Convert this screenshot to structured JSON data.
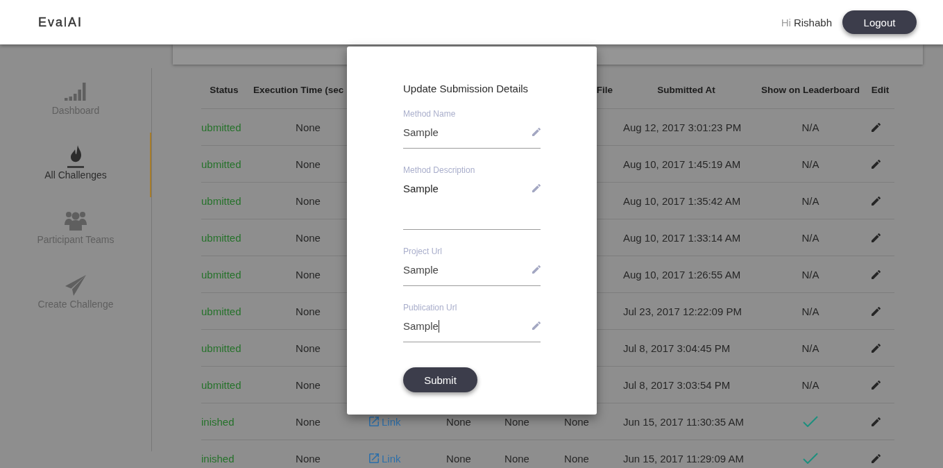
{
  "header": {
    "logo": "EvalAI",
    "greeting": "Hi",
    "user_name": "Rishabh",
    "logout_button": "Logout"
  },
  "sidebar": {
    "items": [
      {
        "label": "Dashboard",
        "selected": false
      },
      {
        "label": "All Challenges",
        "selected": true
      },
      {
        "label": "Participant Teams",
        "selected": false
      },
      {
        "label": "Create Challenge",
        "selected": false
      }
    ]
  },
  "table": {
    "columns": [
      "Status",
      "Execution Time (sec",
      "File",
      "Submitted At",
      "Show on Leaderboard",
      "Edit"
    ],
    "rows": [
      {
        "status": "ubmitted",
        "execution_time": "None",
        "submitted_at": "Aug 12, 2017 3:01:23 PM",
        "leaderboard": "N/A"
      },
      {
        "status": "ubmitted",
        "execution_time": "None",
        "submitted_at": "Aug 10, 2017 1:45:19 AM",
        "leaderboard": "N/A"
      },
      {
        "status": "ubmitted",
        "execution_time": "None",
        "submitted_at": "Aug 10, 2017 1:35:42 AM",
        "leaderboard": "N/A"
      },
      {
        "status": "ubmitted",
        "execution_time": "None",
        "submitted_at": "Aug 10, 2017 1:33:14 AM",
        "leaderboard": "N/A"
      },
      {
        "status": "ubmitted",
        "execution_time": "None",
        "submitted_at": "Aug 10, 2017 1:26:55 AM",
        "leaderboard": "N/A"
      },
      {
        "status": "ubmitted",
        "execution_time": "None",
        "submitted_at": "Jul 23, 2017 12:22:09 PM",
        "leaderboard": "N/A"
      },
      {
        "status": "ubmitted",
        "execution_time": "None",
        "submitted_at": "Jul 8, 2017 3:04:45 PM",
        "leaderboard": "N/A"
      },
      {
        "status": "ubmitted",
        "execution_time": "None",
        "submitted_at": "Jul 8, 2017 3:03:54 PM",
        "leaderboard": "N/A"
      },
      {
        "status": "inished",
        "execution_time": "None",
        "column_3": "Link",
        "column_4": "None",
        "column_5": "None",
        "file": "None",
        "submitted_at": "Jun 15, 2017 11:30:35 AM",
        "on_leaderboard": true
      },
      {
        "status": "inished",
        "execution_time": "None",
        "column_3": "Link",
        "column_4": "None",
        "column_5": "None",
        "file": "None",
        "submitted_at": "Jun 15, 2017 11:29:09 AM",
        "on_leaderboard": true
      }
    ]
  },
  "modal": {
    "title": "Update Submission Details",
    "fields": [
      {
        "kind": "text",
        "label": "Method Name",
        "value": "Sample",
        "focused": false
      },
      {
        "kind": "textarea",
        "label": "Method Description",
        "value": "Sample",
        "focused": false
      },
      {
        "kind": "text",
        "label": "Project Url",
        "value": "Sample",
        "focused": false
      },
      {
        "kind": "text",
        "label": "Publication Url",
        "value": "Sample",
        "focused": true
      }
    ],
    "submit_button": "Submit"
  }
}
